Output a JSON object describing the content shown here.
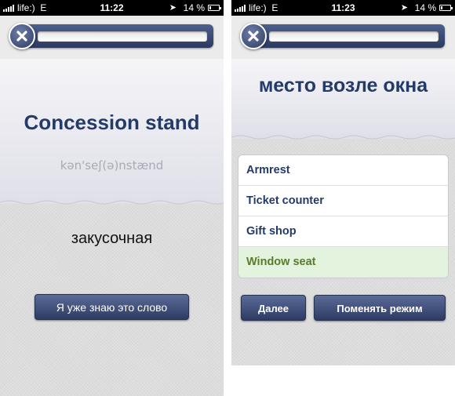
{
  "left": {
    "status": {
      "carrier": "life:)",
      "network": "E",
      "time": "11:22",
      "battery": "14 %"
    },
    "word": "Concession stand",
    "transcription": "kən'seʃ(ə)nstænd",
    "translation": "закусочная",
    "know_button": "Я уже знаю это слово"
  },
  "right": {
    "status": {
      "carrier": "life:)",
      "network": "E",
      "time": "11:23",
      "battery": "14 %"
    },
    "word": "место возле окна",
    "options": [
      {
        "label": "Armrest",
        "state": "normal"
      },
      {
        "label": "Ticket counter",
        "state": "normal"
      },
      {
        "label": "Gift shop",
        "state": "normal"
      },
      {
        "label": "Window seat",
        "state": "correct"
      }
    ],
    "next_button": "Далее",
    "switch_mode_button": "Поменять режим"
  },
  "colors": {
    "accent": "#243a68",
    "button": "#3e4d77",
    "correct_bg": "#e3f3dd",
    "correct_text": "#5a7b2a"
  },
  "icons": [
    "signal-icon",
    "location-arrow-icon",
    "battery-icon",
    "close-icon"
  ]
}
